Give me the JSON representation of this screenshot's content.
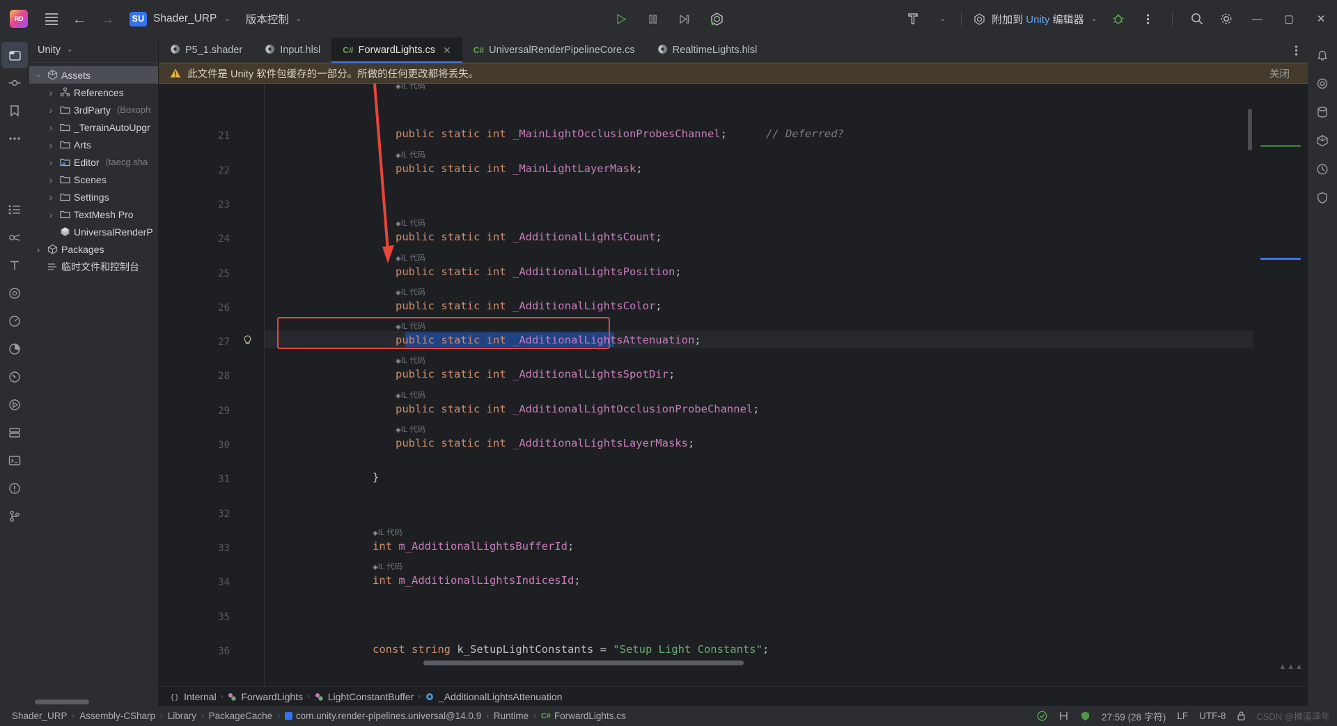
{
  "titlebar": {
    "logo": "rider-logo",
    "menu_icon": "hamburger-menu-icon",
    "back_icon": "back-arrow-icon",
    "forward_icon": "forward-arrow-icon",
    "project_badge": "SU",
    "project_name": "Shader_URP",
    "vcs_label": "版本控制",
    "run_icon": "run-play-icon",
    "pause_icon": "pause-icon",
    "step_icon": "step-over-icon",
    "unity_icon": "unity-refresh-icon",
    "build_icon": "build-hammer-icon",
    "config_icon": "unity-attach-icon",
    "config_label": "附加到 Unity 编辑器",
    "config_label_accent": "Unity",
    "debug_icon": "debug-bug-icon",
    "more_icon": "more-vertical-icon",
    "search_icon": "search-icon",
    "settings_icon": "gear-icon",
    "minimize": "—",
    "maximize": "▢",
    "close": "✕"
  },
  "left_rail": [
    {
      "name": "project-tool-icon",
      "glyph": "project"
    },
    {
      "name": "commit-tool-icon",
      "glyph": "commit"
    },
    {
      "name": "bookmarks-tool-icon",
      "glyph": "bookmark"
    },
    {
      "name": "more-tools-icon",
      "glyph": "dots"
    },
    {
      "name": "todo-tool-icon",
      "glyph": "list"
    },
    {
      "name": "unity-tool-icon",
      "glyph": "unity"
    },
    {
      "name": "typography-tool-icon",
      "glyph": "T"
    },
    {
      "name": "structure-tool-icon",
      "glyph": "structure"
    },
    {
      "name": "profiler-tool-icon",
      "glyph": "gauge"
    },
    {
      "name": "coverage-tool-icon",
      "glyph": "pie"
    },
    {
      "name": "performance-tool-icon",
      "glyph": "speed"
    },
    {
      "name": "run-tool-icon",
      "glyph": "play-circle"
    },
    {
      "name": "services-tool-icon",
      "glyph": "services"
    },
    {
      "name": "terminal-tool-icon",
      "glyph": "terminal"
    },
    {
      "name": "problems-tool-icon",
      "glyph": "warning"
    },
    {
      "name": "branch-tool-icon",
      "glyph": "branch"
    }
  ],
  "right_rail": [
    {
      "name": "notifications-icon",
      "glyph": "bell"
    },
    {
      "name": "ai-assistant-icon",
      "glyph": "ai"
    },
    {
      "name": "database-icon",
      "glyph": "db"
    },
    {
      "name": "unity-package-icon",
      "glyph": "cube"
    },
    {
      "name": "history-icon",
      "glyph": "clock"
    },
    {
      "name": "inspection-icon",
      "glyph": "shield"
    }
  ],
  "project_panel": {
    "title": "Unity",
    "chevron": "chevron-down-icon",
    "tree": [
      {
        "label": "Assets",
        "sub": "",
        "indent": 1,
        "expanded": true,
        "icon": "unity-icon",
        "selected": true,
        "arrow": "down"
      },
      {
        "label": "References",
        "sub": "",
        "indent": 2,
        "expanded": false,
        "icon": "refs-icon",
        "selected": false,
        "arrow": "right"
      },
      {
        "label": "3rdParty",
        "sub": "(Boxoph",
        "indent": 2,
        "expanded": false,
        "icon": "folder-icon",
        "selected": false,
        "arrow": "right"
      },
      {
        "label": "_TerrainAutoUpgr",
        "sub": "",
        "indent": 2,
        "expanded": false,
        "icon": "folder-icon",
        "selected": false,
        "arrow": "right"
      },
      {
        "label": "Arts",
        "sub": "",
        "indent": 2,
        "expanded": false,
        "icon": "folder-icon",
        "selected": false,
        "arrow": "right"
      },
      {
        "label": "Editor",
        "sub": "(taecg.sha",
        "indent": 2,
        "expanded": false,
        "icon": "editor-folder-icon",
        "selected": false,
        "arrow": "right"
      },
      {
        "label": "Scenes",
        "sub": "",
        "indent": 2,
        "expanded": false,
        "icon": "folder-icon",
        "selected": false,
        "arrow": "right"
      },
      {
        "label": "Settings",
        "sub": "",
        "indent": 2,
        "expanded": false,
        "icon": "folder-icon",
        "selected": false,
        "arrow": "right"
      },
      {
        "label": "TextMesh Pro",
        "sub": "",
        "indent": 2,
        "expanded": false,
        "icon": "folder-icon",
        "selected": false,
        "arrow": "right"
      },
      {
        "label": "UniversalRenderP",
        "sub": "",
        "indent": 2,
        "expanded": false,
        "icon": "asset-icon",
        "selected": false,
        "arrow": "none"
      },
      {
        "label": "Packages",
        "sub": "",
        "indent": 1,
        "expanded": false,
        "icon": "package-icon",
        "selected": false,
        "arrow": "right"
      },
      {
        "label": "临时文件和控制台",
        "sub": "",
        "indent": 1,
        "expanded": false,
        "icon": "scratch-icon",
        "selected": false,
        "arrow": "none"
      }
    ]
  },
  "tabs": [
    {
      "label": "P5_1.shader",
      "icon": "shader-file-icon",
      "active": false,
      "closable": false
    },
    {
      "label": "Input.hlsl",
      "icon": "shader-file-icon",
      "active": false,
      "closable": false
    },
    {
      "label": "ForwardLights.cs",
      "icon": "csharp-file-icon",
      "active": true,
      "closable": true
    },
    {
      "label": "UniversalRenderPipelineCore.cs",
      "icon": "csharp-file-icon",
      "active": false,
      "closable": false
    },
    {
      "label": "RealtimeLights.hlsl",
      "icon": "shader-file-icon",
      "active": false,
      "closable": false
    }
  ],
  "tabs_more_icon": "more-vertical-icon",
  "banner": {
    "icon": "warning-triangle-icon",
    "text": "此文件是 Unity 软件包缓存的一部分。所做的任何更改都将丢失。",
    "action": "关闭"
  },
  "code": {
    "hint_label": "IL 代码",
    "lines": [
      {
        "num": "",
        "hint": true,
        "indent": 0,
        "text": ""
      },
      {
        "num": "21",
        "hint": false,
        "indent": 0,
        "tokens": [
          {
            "t": "public ",
            "c": "kw"
          },
          {
            "t": "static ",
            "c": "kw"
          },
          {
            "t": "int ",
            "c": "typ"
          },
          {
            "t": "_MainLightOcclusionProbesChannel",
            "c": "fld"
          },
          {
            "t": ";",
            "c": "punc"
          },
          {
            "t": "      // Deferred?",
            "c": "cmt"
          }
        ]
      },
      {
        "num": "22",
        "hint": true,
        "indent": 0,
        "tokens": [
          {
            "t": "public ",
            "c": "kw"
          },
          {
            "t": "static ",
            "c": "kw"
          },
          {
            "t": "int ",
            "c": "typ"
          },
          {
            "t": "_MainLightLayerMask",
            "c": "fld"
          },
          {
            "t": ";",
            "c": "punc"
          }
        ]
      },
      {
        "num": "23",
        "hint": false,
        "indent": 0,
        "tokens": []
      },
      {
        "num": "24",
        "hint": true,
        "indent": 0,
        "tokens": [
          {
            "t": "public ",
            "c": "kw"
          },
          {
            "t": "static ",
            "c": "kw"
          },
          {
            "t": "int ",
            "c": "typ"
          },
          {
            "t": "_AdditionalLightsCount",
            "c": "fld"
          },
          {
            "t": ";",
            "c": "punc"
          }
        ]
      },
      {
        "num": "25",
        "hint": true,
        "indent": 0,
        "tokens": [
          {
            "t": "public ",
            "c": "kw"
          },
          {
            "t": "static ",
            "c": "kw"
          },
          {
            "t": "int ",
            "c": "typ"
          },
          {
            "t": "_AdditionalLightsPosition",
            "c": "fld"
          },
          {
            "t": ";",
            "c": "punc"
          }
        ]
      },
      {
        "num": "26",
        "hint": true,
        "indent": 0,
        "tokens": [
          {
            "t": "public ",
            "c": "kw"
          },
          {
            "t": "static ",
            "c": "kw"
          },
          {
            "t": "int ",
            "c": "typ"
          },
          {
            "t": "_AdditionalLightsColor",
            "c": "fld"
          },
          {
            "t": ";",
            "c": "punc"
          }
        ]
      },
      {
        "num": "27",
        "hint": true,
        "indent": 0,
        "highlight": true,
        "tokens": [
          {
            "t": "public ",
            "c": "kw"
          },
          {
            "t": "static ",
            "c": "kw"
          },
          {
            "t": "int ",
            "c": "typ"
          },
          {
            "t": "_AdditionalLightsAttenuation",
            "c": "fld"
          },
          {
            "t": ";",
            "c": "punc"
          }
        ]
      },
      {
        "num": "28",
        "hint": true,
        "indent": 0,
        "tokens": [
          {
            "t": "public ",
            "c": "kw"
          },
          {
            "t": "static ",
            "c": "kw"
          },
          {
            "t": "int ",
            "c": "typ"
          },
          {
            "t": "_AdditionalLightsSpotDir",
            "c": "fld"
          },
          {
            "t": ";",
            "c": "punc"
          }
        ]
      },
      {
        "num": "29",
        "hint": true,
        "indent": 0,
        "tokens": [
          {
            "t": "public ",
            "c": "kw"
          },
          {
            "t": "static ",
            "c": "kw"
          },
          {
            "t": "int ",
            "c": "typ"
          },
          {
            "t": "_AdditionalLightOcclusionProbeChannel",
            "c": "fld"
          },
          {
            "t": ";",
            "c": "punc"
          }
        ]
      },
      {
        "num": "30",
        "hint": true,
        "indent": 0,
        "tokens": [
          {
            "t": "public ",
            "c": "kw"
          },
          {
            "t": "static ",
            "c": "kw"
          },
          {
            "t": "int ",
            "c": "typ"
          },
          {
            "t": "_AdditionalLightsLayerMasks",
            "c": "fld"
          },
          {
            "t": ";",
            "c": "punc"
          }
        ]
      },
      {
        "num": "31",
        "hint": false,
        "indent": -1,
        "tokens": [
          {
            "t": "}",
            "c": "punc"
          }
        ]
      },
      {
        "num": "32",
        "hint": false,
        "indent": 0,
        "tokens": []
      },
      {
        "num": "33",
        "hint": true,
        "indent": -1,
        "tokens": [
          {
            "t": "int ",
            "c": "typ"
          },
          {
            "t": "m_AdditionalLightsBufferId",
            "c": "fld"
          },
          {
            "t": ";",
            "c": "punc"
          }
        ]
      },
      {
        "num": "34",
        "hint": true,
        "indent": -1,
        "tokens": [
          {
            "t": "int ",
            "c": "typ"
          },
          {
            "t": "m_AdditionalLightsIndicesId",
            "c": "fld"
          },
          {
            "t": ";",
            "c": "punc"
          }
        ]
      },
      {
        "num": "35",
        "hint": false,
        "indent": 0,
        "tokens": []
      },
      {
        "num": "36",
        "hint": false,
        "indent": -1,
        "tokens": [
          {
            "t": "const ",
            "c": "kw"
          },
          {
            "t": "string ",
            "c": "kw"
          },
          {
            "t": "k_SetupLightConstants",
            "c": "ident"
          },
          {
            "t": " = ",
            "c": "punc"
          },
          {
            "t": "\"Setup Light Constants\"",
            "c": "str"
          },
          {
            "t": ";",
            "c": "punc"
          }
        ]
      }
    ],
    "selected_text": "_AdditionalLightsAttenuation",
    "bulb_icon": "intention-bulb-icon",
    "annotation": {
      "box_color": "#e8453c",
      "arrow_color": "#e8453c"
    }
  },
  "breadcrumb": [
    {
      "label": "Internal",
      "icon": "namespace-icon"
    },
    {
      "label": "ForwardLights",
      "icon": "class-icon"
    },
    {
      "label": "LightConstantBuffer",
      "icon": "class-icon"
    },
    {
      "label": "_AdditionalLightsAttenuation",
      "icon": "field-icon"
    }
  ],
  "statusbar": {
    "path": [
      "Shader_URP",
      "Assembly-CSharp",
      "Library",
      "PackageCache",
      "com.unity.render-pipelines.universal@14.0.9",
      "Runtime",
      "ForwardLights.cs"
    ],
    "file_icon": "csharp-file-icon",
    "package_icon": "package-folder-icon",
    "check_icon": "inspection-ok-icon",
    "analysis_icon": "analysis-icon",
    "shield_icon": "shield-green-icon",
    "caret": "27:59 (28 字符)",
    "line_sep": "LF",
    "encoding": "UTF-8",
    "lock_icon": "lock-icon",
    "watermark": "CSDN @摘溪泽年"
  }
}
